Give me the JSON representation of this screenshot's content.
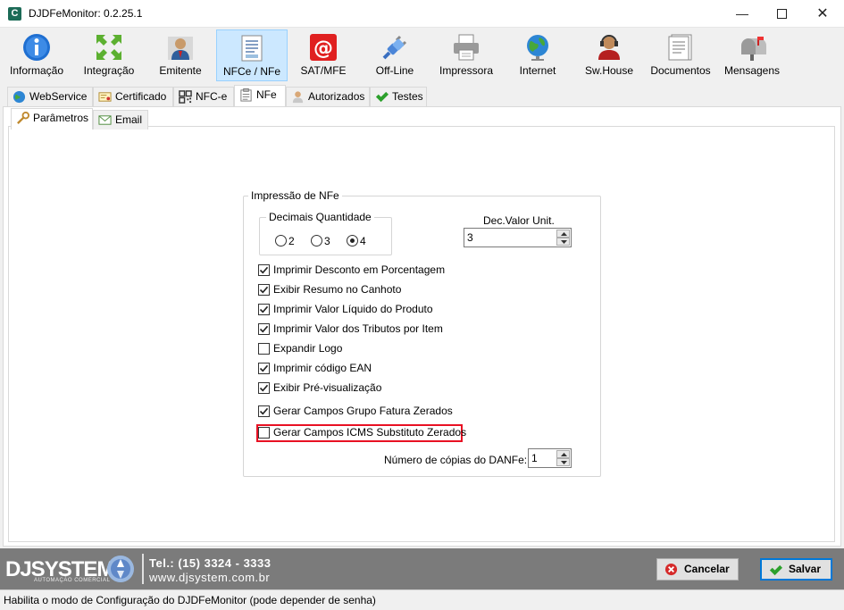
{
  "window": {
    "title": "DJDFeMonitor: 0.2.25.1"
  },
  "toolbar": {
    "items": [
      {
        "label": "Informação",
        "icon": "info-icon"
      },
      {
        "label": "Integração",
        "icon": "arrows-icon"
      },
      {
        "label": "Emitente",
        "icon": "person-icon"
      },
      {
        "label": "NFCe / NFe",
        "icon": "document-icon"
      },
      {
        "label": "SAT/MFE",
        "icon": "at-sign-icon"
      },
      {
        "label": "Off-Line",
        "icon": "plug-icon"
      },
      {
        "label": "Impressora",
        "icon": "printer-icon"
      },
      {
        "label": "Internet",
        "icon": "globe-icon"
      },
      {
        "label": "Sw.House",
        "icon": "headset-person-icon"
      },
      {
        "label": "Documentos",
        "icon": "documents-icon"
      },
      {
        "label": "Mensagens",
        "icon": "mailbox-icon"
      }
    ],
    "active": "NFCe / NFe"
  },
  "tabs": [
    {
      "label": "WebService"
    },
    {
      "label": "Certificado"
    },
    {
      "label": "NFC-e"
    },
    {
      "label": "NFe"
    },
    {
      "label": "Autorizados"
    },
    {
      "label": "Testes"
    }
  ],
  "subtabs": [
    {
      "label": "Parâmetros"
    },
    {
      "label": "Email"
    }
  ],
  "impressao": {
    "group_title": "Impressão de NFe",
    "decimais": {
      "title": "Decimais Quantidade",
      "options": [
        "2",
        "3",
        "4"
      ],
      "selected": "4"
    },
    "dec_valor": {
      "label": "Dec.Valor Unit.",
      "value": "3"
    },
    "checkboxes": [
      {
        "label": "Imprimir Desconto em Porcentagem",
        "checked": true
      },
      {
        "label": "Exibir Resumo no Canhoto",
        "checked": true
      },
      {
        "label": "Imprimir Valor Líquido do Produto",
        "checked": true
      },
      {
        "label": "Imprimir Valor dos Tributos por Item",
        "checked": true
      },
      {
        "label": "Expandir Logo",
        "checked": false
      },
      {
        "label": "Imprimir código EAN",
        "checked": true
      },
      {
        "label": "Exibir Pré-visualização",
        "checked": true
      },
      {
        "label": "Gerar Campos Grupo Fatura Zerados",
        "checked": true
      },
      {
        "label": "Gerar Campos ICMS Substituto Zerados",
        "checked": false
      }
    ],
    "copias": {
      "label": "Número de cópias do DANFe:",
      "value": "1"
    }
  },
  "footer": {
    "logo_main": "DJSYSTEM",
    "logo_sub": "AUTOMAÇÃO COMERCIAL",
    "phone": "Tel.: (15) 3324 - 3333",
    "website": "www.djsystem.com.br",
    "cancel_label": "Cancelar",
    "save_label": "Salvar"
  },
  "status": {
    "text": "Habilita o modo de Configuração do DJDFeMonitor (pode depender de senha)"
  },
  "colors": {
    "accent": "#0078d7",
    "highlight": "#e81123",
    "footer_bg": "#7b7b7b"
  }
}
